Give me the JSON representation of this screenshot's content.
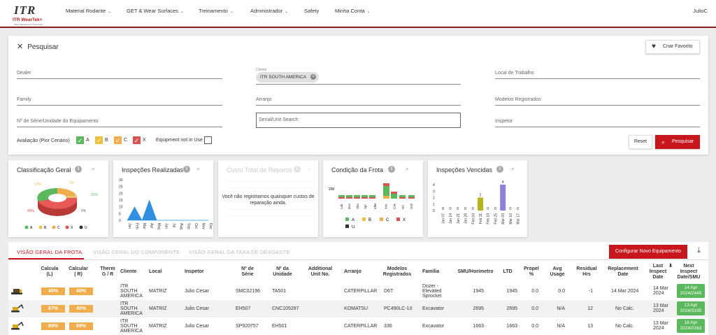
{
  "brand": {
    "logo_top": "ITR",
    "logo_name": "ITR WearTek+",
    "logo_tag": "Wear Management Technology"
  },
  "nav": {
    "items": [
      "Material Rodante",
      "GET & Wear Surfaces",
      "Treinamento",
      "Administrador",
      "Safety",
      "Minha Conta"
    ],
    "user": "JulioC"
  },
  "search": {
    "title": "Pesquisar",
    "fav_label": "Criar Favorito",
    "dealer": "Dealer",
    "cliente_label": "Cliente",
    "cliente_chip": "ITR SOUTH AMERICA",
    "local": "Local de Trabalho",
    "family": "Family",
    "arranjo": "Arranjo",
    "modelos": "Modelos Registrados",
    "serie": "Nº de Série/Unidade do Equipamento",
    "serial_unit": "Serial/Unit Search",
    "inspetor": "Inspetor",
    "avaliacao": "Avaliação (Pior Cenário)",
    "checks": [
      {
        "label": "A",
        "color": "#5cb85c"
      },
      {
        "label": "B",
        "color": "#f0c040"
      },
      {
        "label": "C",
        "color": "#f0ad4e"
      },
      {
        "label": "X",
        "color": "#d9534f"
      }
    ],
    "not_in_use": "Equipment not in Use",
    "reset": "Reset",
    "search_btn": "Pesquisar"
  },
  "cards": {
    "classificacao": {
      "title": "Classificação Geral",
      "labels": [
        "17%",
        "3%",
        "31%",
        "0%",
        "49%"
      ],
      "legend": [
        "A",
        "B",
        "C",
        "X",
        "U"
      ]
    },
    "inspecoes": {
      "title": "Inspeções Realizadas"
    },
    "custo": {
      "title": "Custo Total de Reparos",
      "message": "Você não registramos quaisquer custos de reparação ainda."
    },
    "condicao": {
      "title": "Condição da Frota",
      "ymax": "200",
      "categories": [
        "Lnk",
        "Bus",
        "Sho",
        "Spl",
        "Idler",
        "T/R",
        "C/R",
        "R/I",
        "Grd"
      ],
      "legend": [
        "A",
        "B",
        "C",
        "X",
        "U"
      ]
    },
    "vencidas": {
      "title": "Inspeções Vencidas"
    }
  },
  "chart_data": [
    {
      "type": "bar",
      "title": "Inspeções Realizadas",
      "categories": [
        "Jan",
        "Feb",
        "Mar",
        "Apr",
        "May",
        "Jun",
        "Jul",
        "Aug",
        "Sep",
        "Oct",
        "Nov",
        "Dec"
      ],
      "values": [
        0,
        10,
        0,
        15,
        0,
        0,
        0,
        0,
        0,
        0,
        0,
        0
      ],
      "ylim": [
        0,
        30
      ],
      "yticks": [
        0,
        5,
        10,
        15,
        20,
        25,
        30
      ]
    },
    {
      "type": "bar",
      "title": "Inspeções Vencidas",
      "categories": [
        "Jan 07",
        "Jan 14",
        "Jan 21",
        "Jan 28",
        "Feb 04",
        "Feb 11",
        "Feb 18",
        "Feb 25",
        "Mar 03",
        "Mar 10",
        "Mar 17"
      ],
      "values": [
        0,
        0,
        0,
        0,
        0,
        2,
        0,
        0,
        4,
        0,
        0
      ],
      "ylim": [
        0,
        4
      ],
      "yticks": [
        0,
        1,
        2,
        3,
        4
      ]
    }
  ],
  "table": {
    "tabs": [
      "VISÃO GERAL DA FROTA",
      "VISÃO GERAL DO COMPONENTE",
      "VISÃO GERAL DA TAXA DE DESGASTE"
    ],
    "config_btn": "Configurar Novo Equipamento",
    "headers": [
      "Calcula (L)",
      "Calcular ( R)",
      "Therm G / R",
      "Cliente",
      "Local",
      "Inspetor",
      "Nº de Série",
      "Nº da Unidade",
      "Additional Unit No.",
      "Arranjo",
      "Modelos Registrados",
      "Família",
      "SMU/Horímetro",
      "LTD",
      "Propel %",
      "Avg Usage",
      "Residual Hrs",
      "Replacement Date",
      "Last Inspect Date",
      "Next Inspect Date/SMU"
    ],
    "rows": [
      {
        "l": "40%",
        "r": "40%",
        "cliente": "ITR SOUTH AMERICA",
        "local": "MATRIZ",
        "inspetor": "Julio Cesar",
        "serie": "SMC02196",
        "unidade": "TA501",
        "arranjo": "CATERPILLAR",
        "modelo": "D6T",
        "familia": "Dozer - Elevated Sprocket",
        "smu": "1945",
        "ltd": "1945",
        "propel": "0.0",
        "avg": "0.0",
        "resid": "-1",
        "repl": "14 Mar 2024",
        "last": "14 Mar 2024",
        "next": "14 Apr 2024/2445"
      },
      {
        "l": "67%",
        "r": "40%",
        "cliente": "ITR SOUTH AMERICA",
        "local": "MATRIZ",
        "inspetor": "Julio Cesar",
        "serie": "EH507",
        "unidade": "CNC105287",
        "arranjo": "KOMATSU",
        "modelo": "PC490LC-10",
        "familia": "Excavator",
        "smu": "2695",
        "ltd": "2695",
        "propel": "0.0",
        "avg": "N/A",
        "resid": "12",
        "repl": "No Calc.",
        "last": "13 Mar 2024",
        "next": "13 Apr 2024/3195"
      },
      {
        "l": "69%",
        "r": "69%",
        "cliente": "ITR SOUTH AMERICA",
        "local": "MATRIZ",
        "inspetor": "Julio Cesar",
        "serie": "SP920757",
        "unidade": "EH501",
        "arranjo": "CATERPILLAR",
        "modelo": "336",
        "familia": "Excavator",
        "smu": "1663",
        "ltd": "1663",
        "propel": "0.0",
        "avg": "N/A",
        "resid": "13",
        "repl": "No Calc.",
        "last": "13 Mar 2024",
        "next": "18 Apr 2024/2163"
      }
    ]
  }
}
